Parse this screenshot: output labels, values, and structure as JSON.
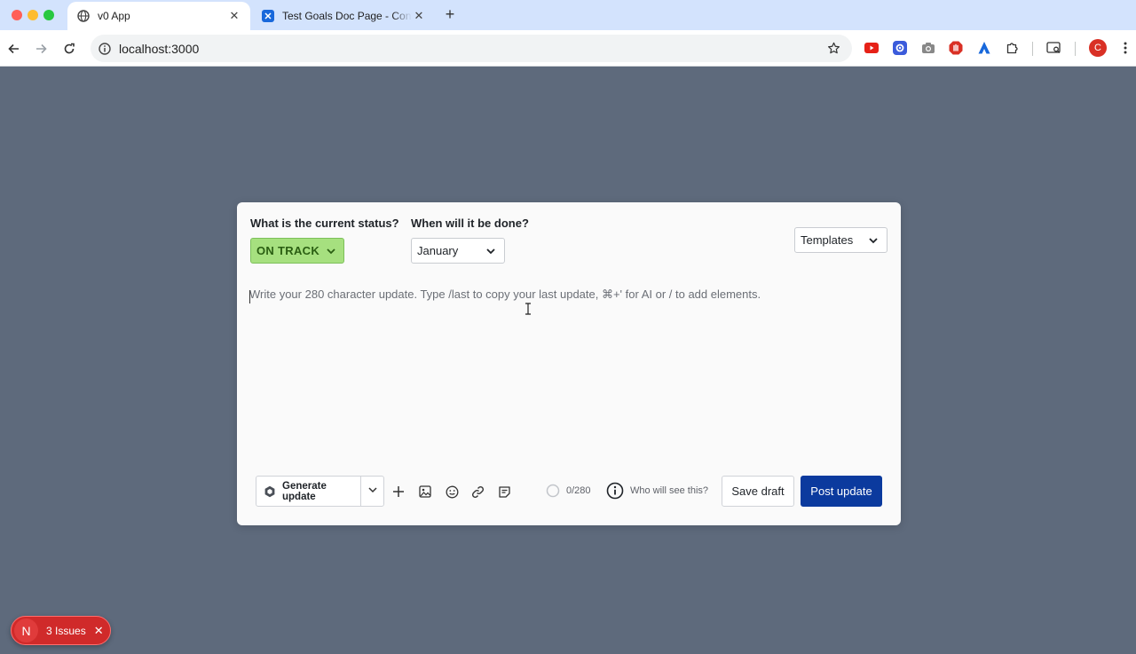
{
  "browser": {
    "tabs": [
      {
        "title": "v0 App",
        "favicon": "globe-icon",
        "active": true
      },
      {
        "title": "Test Goals Doc Page - Confluence",
        "favicon": "confluence-icon",
        "active": false
      }
    ],
    "url": "localhost:3000",
    "profile_initial": "C",
    "extensions": [
      "youtube-icon",
      "gear-extension-icon",
      "camera-icon",
      "hand-stop-icon",
      "atlassian-icon",
      "puzzle-icon"
    ]
  },
  "modal": {
    "status_label": "What is the current status?",
    "status_value": "ON TRACK",
    "due_label": "When will it be done?",
    "due_value": "January",
    "templates_label": "Templates",
    "editor_placeholder": "Write your 280 character update. Type /last to copy your last update, ⌘+' for AI or / to add elements.",
    "toolbar": {
      "generate_label": "Generate update",
      "char_count": "0/280",
      "char_used": 0,
      "char_max": 280,
      "who_label": "Who will see this?",
      "save_draft_label": "Save draft",
      "post_label": "Post update"
    }
  },
  "dev_overlay": {
    "logo_letter": "N",
    "issues_label": "3 Issues"
  },
  "colors": {
    "page_background": "#5e6a7c",
    "status_green": "#a6e07f",
    "post_button": "#0b3a9e",
    "issues_red": "#d02a2a"
  }
}
